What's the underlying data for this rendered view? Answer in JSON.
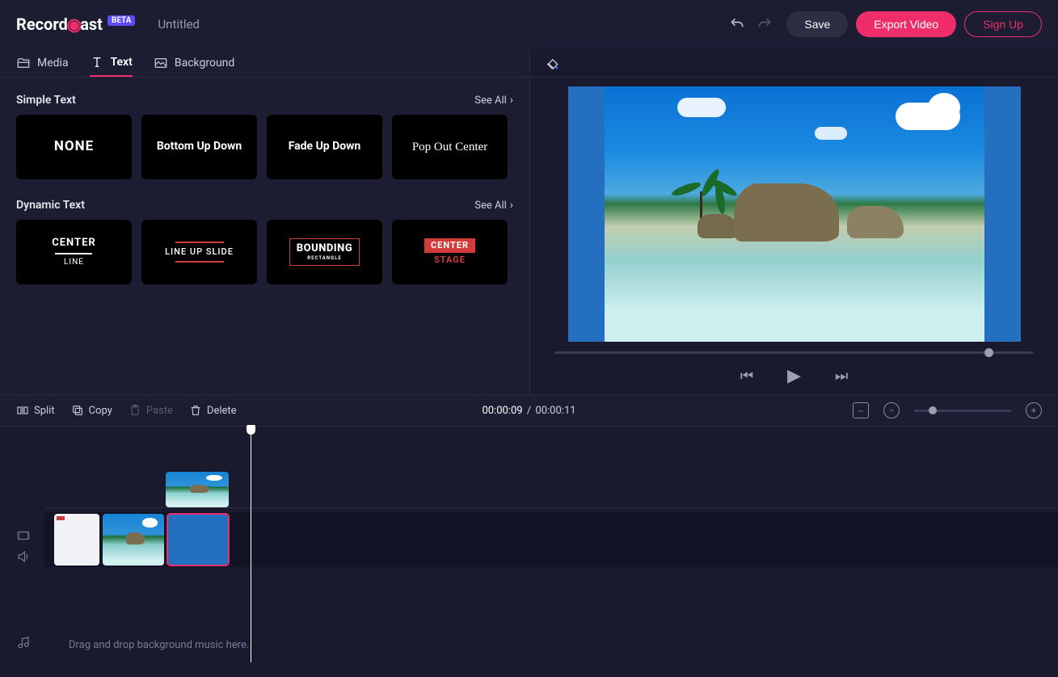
{
  "brand": {
    "name1": "Record",
    "name2": "ast",
    "beta": "BETA"
  },
  "project_title": "Untitled",
  "header": {
    "save": "Save",
    "export": "Export Video",
    "signup": "Sign Up"
  },
  "tabs": {
    "media": "Media",
    "text": "Text",
    "background": "Background"
  },
  "sections": {
    "simple": {
      "title": "Simple Text",
      "see_all": "See All"
    },
    "dynamic": {
      "title": "Dynamic Text",
      "see_all": "See All"
    }
  },
  "simple_cards": {
    "none": "NONE",
    "bottom": "Bottom Up Down",
    "fade": "Fade Up Down",
    "pop": "Pop Out Center"
  },
  "dynamic_cards": {
    "centerline": {
      "l1": "CENTER",
      "l2": "LINE"
    },
    "lineup": "LINE UP SLIDE",
    "bounding": {
      "l1": "BOUNDING",
      "l2": "RECTANGLE"
    },
    "centerstage": {
      "l1": "CENTER",
      "l2": "STAGE"
    }
  },
  "toolbar": {
    "split": "Split",
    "copy": "Copy",
    "paste": "Paste",
    "delete": "Delete"
  },
  "time": {
    "current": "00:00:09",
    "sep": "/",
    "total": "00:00:11"
  },
  "audio_hint": "Drag and drop background music here.",
  "colors": {
    "accent": "#ef2d6a",
    "bg": "#191a2e"
  }
}
